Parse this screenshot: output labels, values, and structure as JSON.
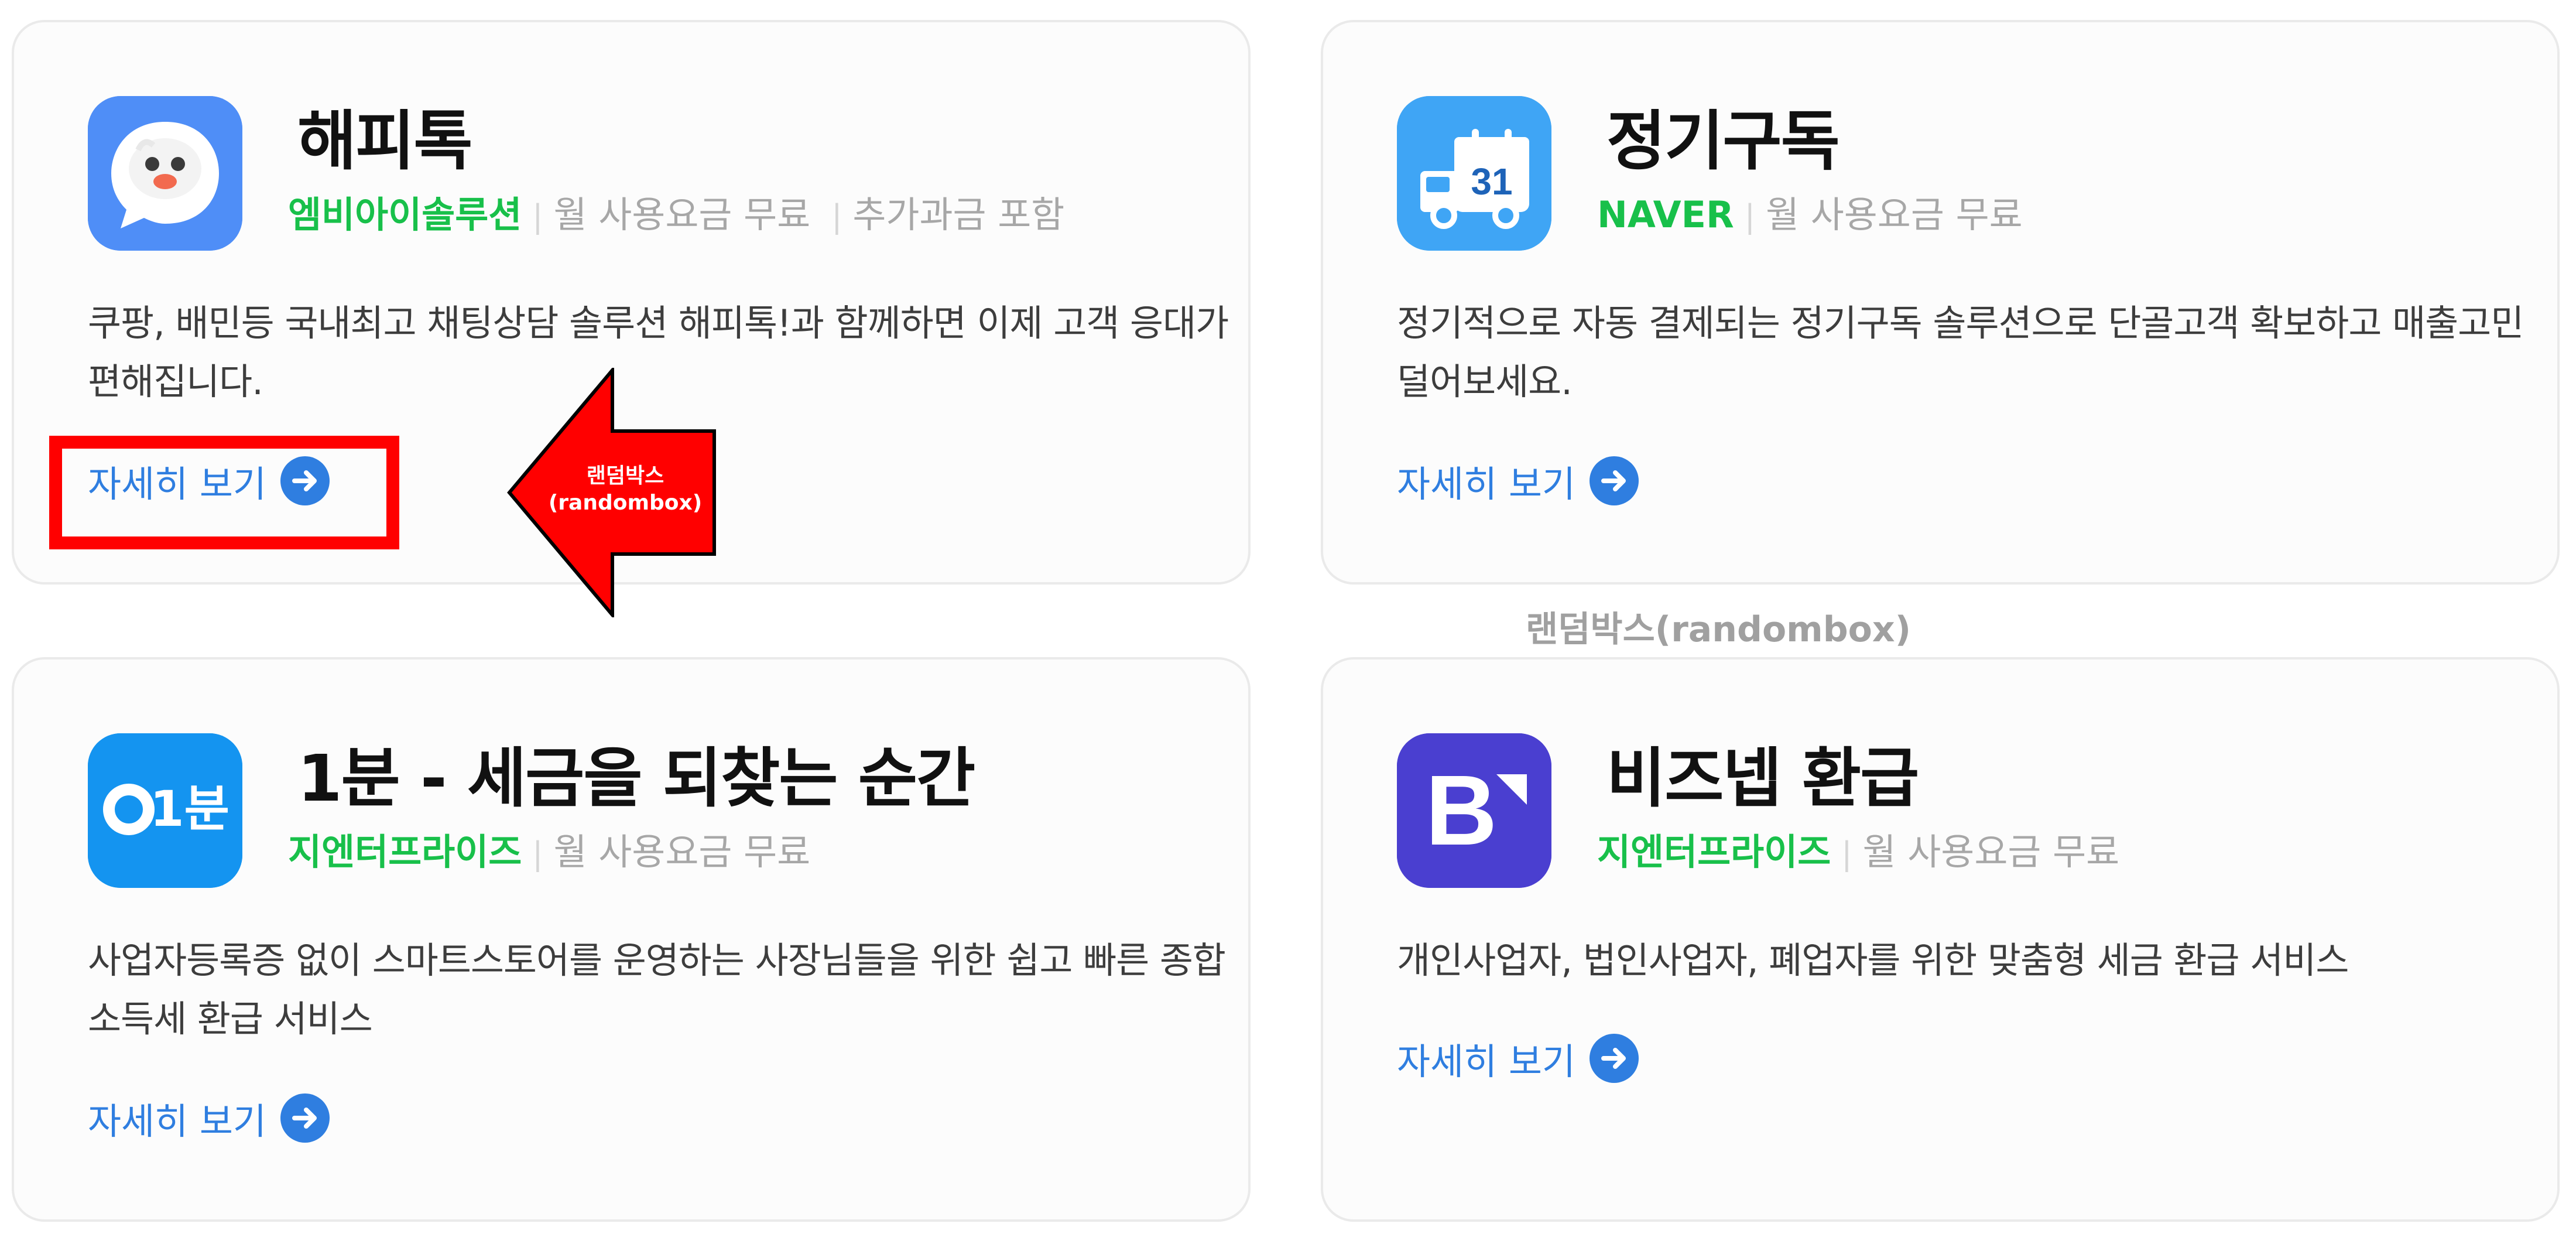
{
  "cards": [
    {
      "icon": "happytalk-chat-bird-icon",
      "title": "해피톡",
      "provider": "엠비아이솔루션",
      "fee": "월 사용요금 무료",
      "extra": "추가과금 포함",
      "desc_lines": [
        "쿠팡, 배민등 국내최고 채팅상담 솔루션 해피톡!과 함께하면 이제 고객 응대가",
        "편해집니다."
      ],
      "more_label": "자세히 보기"
    },
    {
      "icon": "subscription-truck-calendar-icon",
      "icon_text": "31",
      "title": "정기구독",
      "provider": "NAVER",
      "fee": "월 사용요금 무료",
      "desc_lines": [
        "정기적으로 자동 결제되는 정기구독 솔루션으로 단골고객 확보하고 매출고민",
        "덜어보세요."
      ],
      "more_label": "자세히 보기"
    },
    {
      "icon": "1bun-logo-icon",
      "icon_text": "1분",
      "title": "1분 - 세금을 되찾는 순간",
      "provider": "지엔터프라이즈",
      "fee": "월 사용요금 무료",
      "desc_lines": [
        "사업자등록증 없이 스마트스토어를 운영하는 사장님들을 위한 쉽고 빠른 종합",
        "소득세 환급 서비스"
      ],
      "more_label": "자세히 보기"
    },
    {
      "icon": "biznep-b-logo-icon",
      "icon_text": "B",
      "title": "비즈넵 환급",
      "provider": "지엔터프라이즈",
      "fee": "월 사용요금 무료",
      "desc_lines": [
        "개인사업자, 법인사업자, 폐업자를 위한 맞춤형 세금 환급 서비스"
      ],
      "more_label": "자세히 보기"
    }
  ],
  "annotation": {
    "callout_line1": "랜덤박스",
    "callout_line2": "(randombox)",
    "watermark": "랜덤박스(randombox)"
  },
  "colors": {
    "provider_green": "#18c04a",
    "link_blue": "#2f7ee0",
    "highlight_red": "#ff0000",
    "happytalk_blue": "#4f8ef7",
    "subscription_blue": "#3fa5f5",
    "onebun_blue": "#1494f0",
    "biznep_purple": "#4a3fd0"
  }
}
